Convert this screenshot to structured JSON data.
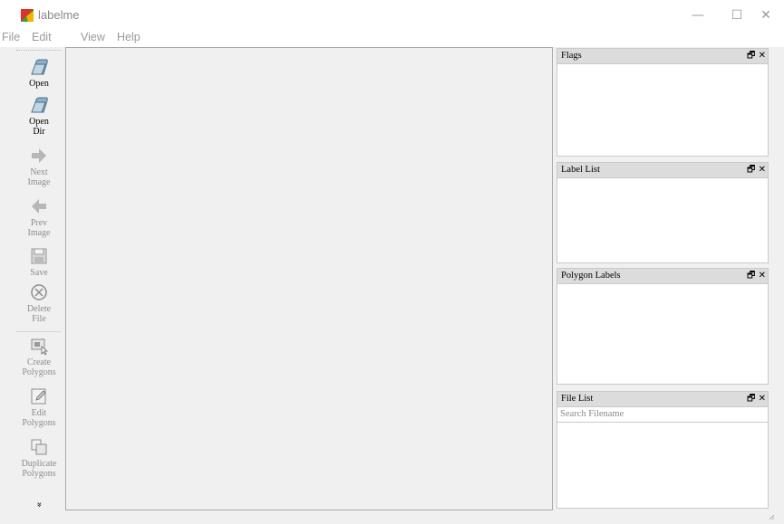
{
  "window": {
    "title": "labelme",
    "minimize": "—",
    "maximize": "☐",
    "close": "✕",
    "icon_colors": [
      "#d9332b",
      "#3e9b3a",
      "#f2b400"
    ]
  },
  "menu": [
    "File",
    "Edit",
    "View",
    "Help"
  ],
  "toolbar": {
    "tools": [
      {
        "label": "Open",
        "icon": "folder-open-icon",
        "enabled": true
      },
      {
        "label": "Open\nDir",
        "icon": "folder-open-dir-icon",
        "enabled": true
      },
      {
        "label": "Next\nImage",
        "icon": "arrow-right-icon",
        "enabled": false
      },
      {
        "label": "Prev\nImage",
        "icon": "arrow-left-icon",
        "enabled": false
      },
      {
        "label": "Save",
        "icon": "floppy-disk-icon",
        "enabled": false
      },
      {
        "label": "Delete\nFile",
        "icon": "circle-x-icon",
        "enabled": false
      },
      {
        "label": "Create\nPolygons",
        "icon": "create-polygon-icon",
        "enabled": false
      },
      {
        "label": "Edit\nPolygons",
        "icon": "edit-polygon-icon",
        "enabled": false
      },
      {
        "label": "Duplicate\nPolygons",
        "icon": "duplicate-icon",
        "enabled": false
      }
    ],
    "more": "»"
  },
  "docks": {
    "flags": {
      "title": "Flags"
    },
    "label_list": {
      "title": "Label List"
    },
    "polygon_labels": {
      "title": "Polygon Labels"
    },
    "file_list": {
      "title": "File List",
      "search_placeholder": "Search Filename"
    },
    "float_glyph": "🗗",
    "close_glyph": "✕"
  }
}
